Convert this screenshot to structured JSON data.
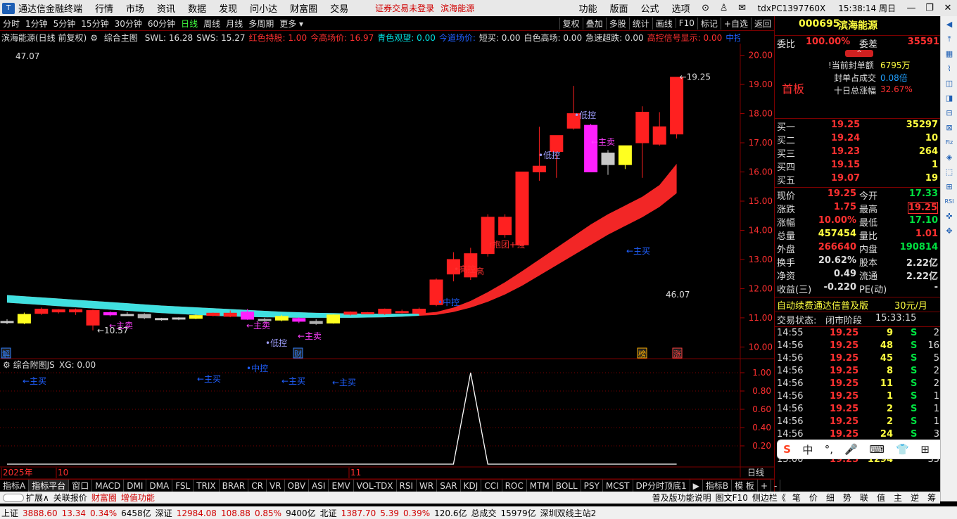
{
  "titlebar": {
    "app_name": "通达信金融终端",
    "menu": [
      "行情",
      "市场",
      "资讯",
      "数据",
      "发现",
      "问小达",
      "财富圈",
      "交易"
    ],
    "notice": "证券交易未登录",
    "stock_name": "滨海能源",
    "right_menu": [
      "功能",
      "版面",
      "公式",
      "选项"
    ],
    "terminal_id": "tdxPC1397760X",
    "time": "15:38:14 周日",
    "window_buttons": [
      "—",
      "❐",
      "✕"
    ]
  },
  "periodbar": {
    "periods": [
      "分时",
      "1分钟",
      "5分钟",
      "15分钟",
      "30分钟",
      "60分钟",
      "日线",
      "周线",
      "月线",
      "多周期",
      "更多"
    ],
    "active": "日线",
    "right_tools": [
      "复权",
      "叠加",
      "多股",
      "统计",
      "画线",
      "F10",
      "标记",
      "+自选",
      "返回"
    ]
  },
  "indicator_line": {
    "title": "滨海能源(日线 前复权)",
    "formula": "综合主图",
    "items": [
      {
        "text": "SWL: 16.28",
        "color": "#dddddd"
      },
      {
        "text": "SWS: 15.27",
        "color": "#dddddd"
      },
      {
        "text": "红色持股: 1.00",
        "color": "#ff3030"
      },
      {
        "text": "今高场价: 16.97",
        "color": "#ff3030"
      },
      {
        "text": "青色观望: 0.00",
        "color": "#00e0e0"
      },
      {
        "text": "今道场价:",
        "color": "#2060ff"
      },
      {
        "text": "短买: 0.00",
        "color": "#dddddd"
      },
      {
        "text": "白色高场: 0.00",
        "color": "#dddddd"
      },
      {
        "text": "急速超跌: 0.00",
        "color": "#dddddd"
      },
      {
        "text": "高控信号显示: 0.00",
        "color": "#ff3030"
      },
      {
        "text": "中控信◇",
        "color": "#2060ff"
      }
    ]
  },
  "main_chart": {
    "high_label": "47.07",
    "low_label": "46.07",
    "price_marks": {
      "max": "19.25",
      "min": "10.57"
    },
    "y_axis": [
      "20.00",
      "19.00",
      "18.00",
      "17.00",
      "16.00",
      "15.00",
      "14.00",
      "13.00",
      "12.00",
      "11.00",
      "10.00"
    ],
    "x_labels": [
      "2025年",
      "10",
      "11"
    ],
    "x_axis_corner": "日线",
    "event_tags": [
      {
        "text": "解",
        "color": "#3080ff"
      },
      {
        "text": "财",
        "color": "#3080ff"
      },
      {
        "text": "榜",
        "color": "#ffb000"
      },
      {
        "text": "涨",
        "color": "#ff4040"
      }
    ],
    "annotations": [
      {
        "text": "←主卖",
        "color": "#ff40ff"
      },
      {
        "text": "←主卖",
        "color": "#ff40ff"
      },
      {
        "text": "←主卖",
        "color": "#ff40ff"
      },
      {
        "text": "←主卖",
        "color": "#ff40ff"
      },
      {
        "text": "•低控",
        "color": "#a0a0ff"
      },
      {
        "text": "•低控",
        "color": "#a0a0ff"
      },
      {
        "text": "•低控",
        "color": "#a0a0ff"
      },
      {
        "text": "←主买",
        "color": "#2060ff"
      },
      {
        "text": "←主买",
        "color": "#2060ff"
      },
      {
        "text": "←主买",
        "color": "#2060ff"
      },
      {
        "text": "←主买",
        "color": "#2060ff"
      },
      {
        "text": "←主买",
        "color": "#2060ff"
      },
      {
        "text": "•中控",
        "color": "#2060ff"
      },
      {
        "text": "•中控",
        "color": "#2060ff"
      },
      {
        "text": "•高控",
        "color": "#ff3030"
      },
      {
        "text": "高",
        "color": "#ff3030"
      },
      {
        "text": "r抱团+强",
        "color": "#ff3030"
      }
    ]
  },
  "chart_data": {
    "type": "candlestick",
    "candles": [
      {
        "o": 10.85,
        "h": 10.95,
        "l": 10.78,
        "c": 10.88,
        "col": "w"
      },
      {
        "o": 10.82,
        "h": 11.18,
        "l": 10.78,
        "c": 11.12,
        "col": "y"
      },
      {
        "o": 11.15,
        "h": 11.35,
        "l": 11.1,
        "c": 11.3,
        "col": "r"
      },
      {
        "o": 11.28,
        "h": 11.3,
        "l": 11.15,
        "c": 11.2,
        "col": "r"
      },
      {
        "o": 11.2,
        "h": 11.32,
        "l": 11.1,
        "c": 11.28,
        "col": "r"
      },
      {
        "o": 11.25,
        "h": 11.28,
        "l": 10.57,
        "c": 10.75,
        "col": "r"
      },
      {
        "o": 11.1,
        "h": 11.22,
        "l": 11.05,
        "c": 11.18,
        "col": "m"
      },
      {
        "o": 11.12,
        "h": 11.2,
        "l": 11.08,
        "c": 11.1,
        "col": "w"
      },
      {
        "o": 11.12,
        "h": 11.16,
        "l": 10.95,
        "c": 11.0,
        "col": "g"
      },
      {
        "o": 10.98,
        "h": 11.0,
        "l": 10.9,
        "c": 10.94,
        "col": "w"
      },
      {
        "o": 10.96,
        "h": 11.02,
        "l": 10.92,
        "c": 11.0,
        "col": "w"
      },
      {
        "o": 10.98,
        "h": 11.12,
        "l": 10.95,
        "c": 11.08,
        "col": "y"
      },
      {
        "o": 11.08,
        "h": 11.18,
        "l": 11.05,
        "c": 11.16,
        "col": "r"
      },
      {
        "o": 11.16,
        "h": 11.25,
        "l": 11.02,
        "c": 11.05,
        "col": "r"
      },
      {
        "o": 11.2,
        "h": 11.3,
        "l": 10.93,
        "c": 10.95,
        "col": "m"
      },
      {
        "o": 10.95,
        "h": 11.0,
        "l": 10.85,
        "c": 10.92,
        "col": "g"
      },
      {
        "o": 10.92,
        "h": 11.1,
        "l": 10.88,
        "c": 11.05,
        "col": "y"
      },
      {
        "o": 10.98,
        "h": 11.02,
        "l": 10.82,
        "c": 10.88,
        "col": "m"
      },
      {
        "o": 10.88,
        "h": 10.95,
        "l": 10.76,
        "c": 10.8,
        "col": "g"
      },
      {
        "o": 10.82,
        "h": 11.12,
        "l": 10.8,
        "c": 11.1,
        "col": "y"
      },
      {
        "o": 11.12,
        "h": 11.22,
        "l": 11.08,
        "c": 11.2,
        "col": "r"
      },
      {
        "o": 11.16,
        "h": 11.2,
        "l": 11.12,
        "c": 11.18,
        "col": "r"
      },
      {
        "o": 11.14,
        "h": 11.32,
        "l": 11.1,
        "c": 11.3,
        "col": "r"
      },
      {
        "o": 11.2,
        "h": 11.28,
        "l": 11.15,
        "c": 11.22,
        "col": "r"
      },
      {
        "o": 11.15,
        "h": 11.35,
        "l": 11.12,
        "c": 11.3,
        "col": "r"
      },
      {
        "o": 11.45,
        "h": 12.35,
        "l": 11.4,
        "c": 12.3,
        "col": "r"
      },
      {
        "o": 12.5,
        "h": 13.25,
        "l": 12.25,
        "c": 13.0,
        "col": "r"
      },
      {
        "o": 12.4,
        "h": 13.4,
        "l": 12.3,
        "c": 13.2,
        "col": "r"
      },
      {
        "o": 13.2,
        "h": 14.55,
        "l": 13.1,
        "c": 14.45,
        "col": "r"
      },
      {
        "o": 14.45,
        "h": 14.55,
        "l": 13.75,
        "c": 13.85,
        "col": "r"
      },
      {
        "o": 13.5,
        "h": 16.0,
        "l": 13.45,
        "c": 16.0,
        "col": "r"
      },
      {
        "o": 16.0,
        "h": 17.55,
        "l": 15.7,
        "c": 16.2,
        "col": "r"
      },
      {
        "o": 16.7,
        "h": 17.25,
        "l": 15.8,
        "c": 17.25,
        "col": "r"
      },
      {
        "o": 17.5,
        "h": 18.95,
        "l": 17.45,
        "c": 18.0,
        "col": "r"
      },
      {
        "o": 17.6,
        "h": 17.65,
        "l": 16.0,
        "c": 16.0,
        "col": "m"
      },
      {
        "o": 16.65,
        "h": 16.75,
        "l": 15.9,
        "c": 16.25,
        "col": "w"
      },
      {
        "o": 16.25,
        "h": 16.9,
        "l": 16.1,
        "c": 16.9,
        "col": "y"
      },
      {
        "o": 17.0,
        "h": 18.25,
        "l": 15.8,
        "c": 18.05,
        "col": "r"
      },
      {
        "o": 16.95,
        "h": 18.05,
        "l": 16.9,
        "c": 17.55,
        "col": "r"
      },
      {
        "o": 17.3,
        "h": 19.25,
        "l": 17.15,
        "c": 19.25,
        "col": "r"
      }
    ],
    "band_upper": [
      11.78,
      11.74,
      11.7,
      11.66,
      11.62,
      11.58,
      11.54,
      11.5,
      11.46,
      11.42,
      11.39,
      11.36,
      11.33,
      11.3,
      11.27,
      11.24,
      11.21,
      11.19,
      11.17,
      11.16,
      11.15,
      11.14,
      11.14,
      11.14,
      11.15,
      11.2,
      11.35,
      11.58,
      11.88,
      12.22,
      12.6,
      13.0,
      13.4,
      13.8,
      14.2,
      14.55,
      14.85,
      15.15,
      15.55,
      16.28
    ],
    "band_lower": [
      11.52,
      11.48,
      11.44,
      11.4,
      11.36,
      11.32,
      11.28,
      11.24,
      11.2,
      11.16,
      11.13,
      11.1,
      11.07,
      11.05,
      11.03,
      11.02,
      11.01,
      11.0,
      11.0,
      11.0,
      11.0,
      11.01,
      11.02,
      11.04,
      11.07,
      11.1,
      11.2,
      11.35,
      11.55,
      11.8,
      12.1,
      12.45,
      12.8,
      13.15,
      13.5,
      13.85,
      14.15,
      14.45,
      14.8,
      15.27
    ],
    "ylim": [
      9.6,
      20.4
    ],
    "sub_indicator": {
      "name": "综合附图JS",
      "value_label": "XG: 0.00",
      "peak_index": 27,
      "values_axis": [
        "1.00",
        "0.80",
        "0.60",
        "0.40",
        "0.20"
      ]
    }
  },
  "right_panel": {
    "code": "000695",
    "name": "滨海能源",
    "weibi_label": "委比",
    "weibi_value": "100.00%",
    "weicha_label": "委差",
    "weicha_value": "35591",
    "first_board": "首板",
    "seal_amount_label": "!当前封单额",
    "seal_amount": "6795万",
    "seal_ratio_label": "封单占成交",
    "seal_ratio": "0.08倍",
    "ten_day_label": "十日总涨幅",
    "ten_day_value": "32.67%",
    "buys": [
      {
        "label": "买一",
        "price": "19.25",
        "vol": "35297"
      },
      {
        "label": "买二",
        "price": "19.24",
        "vol": "10"
      },
      {
        "label": "买三",
        "price": "19.23",
        "vol": "264"
      },
      {
        "label": "买四",
        "price": "19.15",
        "vol": "1"
      },
      {
        "label": "买五",
        "price": "19.07",
        "vol": "19"
      }
    ],
    "quote": [
      {
        "l1": "现价",
        "v1": "19.25",
        "c1": "#ff3030",
        "l2": "今开",
        "v2": "17.33",
        "c2": "#00e040"
      },
      {
        "l1": "涨跌",
        "v1": "1.75",
        "c1": "#ff3030",
        "l2": "最高",
        "v2": "19.25",
        "c2": "#ff3030"
      },
      {
        "l1": "涨幅",
        "v1": "10.00%",
        "c1": "#ff3030",
        "l2": "最低",
        "v2": "17.10",
        "c2": "#00e040"
      },
      {
        "l1": "总量",
        "v1": "457454",
        "c1": "#ffff40",
        "l2": "量比",
        "v2": "1.01",
        "c2": "#ff3030"
      },
      {
        "l1": "外盘",
        "v1": "266640",
        "c1": "#ff3030",
        "l2": "内盘",
        "v2": "190814",
        "c2": "#00e040"
      },
      {
        "l1": "换手",
        "v1": "20.62%",
        "c1": "#dddddd",
        "l2": "股本",
        "v2": "2.22亿",
        "c2": "#dddddd"
      },
      {
        "l1": "净资",
        "v1": "0.49",
        "c1": "#dddddd",
        "l2": "流通",
        "v2": "2.22亿",
        "c2": "#dddddd"
      },
      {
        "l1": "收益(三)",
        "v1": "-0.220",
        "c1": "#dddddd",
        "l2": "PE(动)",
        "v2": "-",
        "c2": "#dddddd"
      }
    ],
    "ad_text": "自动续费通达信普及版",
    "ad_price": "30元/月",
    "trade_status_label": "交易状态:",
    "trade_status": "闭市阶段",
    "trade_status_time": "15:33:15",
    "ticks": [
      {
        "t": "14:55",
        "p": "19.25",
        "v": "9",
        "s": "S",
        "n": "2"
      },
      {
        "t": "14:56",
        "p": "19.25",
        "v": "48",
        "s": "S",
        "n": "16"
      },
      {
        "t": "14:56",
        "p": "19.25",
        "v": "45",
        "s": "S",
        "n": "5"
      },
      {
        "t": "14:56",
        "p": "19.25",
        "v": "8",
        "s": "S",
        "n": "2"
      },
      {
        "t": "14:56",
        "p": "19.25",
        "v": "11",
        "s": "S",
        "n": "2"
      },
      {
        "t": "14:56",
        "p": "19.25",
        "v": "1",
        "s": "S",
        "n": "1"
      },
      {
        "t": "14:56",
        "p": "19.25",
        "v": "2",
        "s": "S",
        "n": "1"
      },
      {
        "t": "14:56",
        "p": "19.25",
        "v": "2",
        "s": "S",
        "n": "1"
      },
      {
        "t": "14:56",
        "p": "19.25",
        "v": "24",
        "s": "S",
        "n": "3"
      },
      {
        "t": "14:57",
        "p": "19.25",
        "v": "58",
        "s": "S",
        "n": "2"
      },
      {
        "t": "15:00",
        "p": "19.25",
        "v": "1294",
        "s": "",
        "n": "35"
      }
    ]
  },
  "ime_bar": [
    "S",
    "中",
    "°,",
    "🎤",
    "⌨",
    "👕",
    "⊞",
    "⚙"
  ],
  "tabbar": {
    "tabs": [
      "指标A",
      "指标平台",
      "窗口",
      "MACD",
      "DMI",
      "DMA",
      "FSL",
      "TRIX",
      "BRAR",
      "CR",
      "VR",
      "OBV",
      "ASI",
      "EMV",
      "VOL-TDX",
      "RSI",
      "WR",
      "SAR",
      "KDJ",
      "CCI",
      "ROC",
      "MTM",
      "BOLL",
      "PSY",
      "MCST",
      "DP分时顶底1",
      "▶",
      "指标B",
      "模 板",
      "+",
      "-"
    ],
    "active": "指标平台"
  },
  "funcbar": {
    "left": [
      "扩展∧",
      "关联报价",
      "财富圈",
      "增值功能"
    ],
    "right": [
      "普及版功能说明",
      "图文F10",
      "侧边栏《",
      "笔",
      "价",
      "细",
      "势",
      "联",
      "值",
      "主",
      "逆",
      "筹"
    ]
  },
  "statusbar": [
    {
      "t": "上证",
      "c": "#000000"
    },
    {
      "t": "3888.60",
      "c": "#d00000"
    },
    {
      "t": "13.34",
      "c": "#d00000"
    },
    {
      "t": "0.34%",
      "c": "#d00000"
    },
    {
      "t": "6458亿",
      "c": "#000000"
    },
    {
      "t": "深证",
      "c": "#000000"
    },
    {
      "t": "12984.08",
      "c": "#d00000"
    },
    {
      "t": "108.88",
      "c": "#d00000"
    },
    {
      "t": "0.85%",
      "c": "#d00000"
    },
    {
      "t": "9400亿",
      "c": "#000000"
    },
    {
      "t": "北证",
      "c": "#000000"
    },
    {
      "t": "1387.70",
      "c": "#d00000"
    },
    {
      "t": "5.39",
      "c": "#d00000"
    },
    {
      "t": "0.39%",
      "c": "#d00000"
    },
    {
      "t": "120.6亿",
      "c": "#000000"
    },
    {
      "t": "总成交",
      "c": "#000000"
    },
    {
      "t": "15979亿",
      "c": "#000000"
    },
    {
      "t": "深圳双线主站2",
      "c": "#000000"
    }
  ],
  "vscroll_icons": [
    "◀",
    "⤒",
    "▦",
    "⌇",
    "◫",
    "◨",
    "⊟",
    "⊠",
    "Fiz",
    "◈",
    "⬚",
    "⊞",
    "RSI",
    "✜",
    "✥"
  ]
}
